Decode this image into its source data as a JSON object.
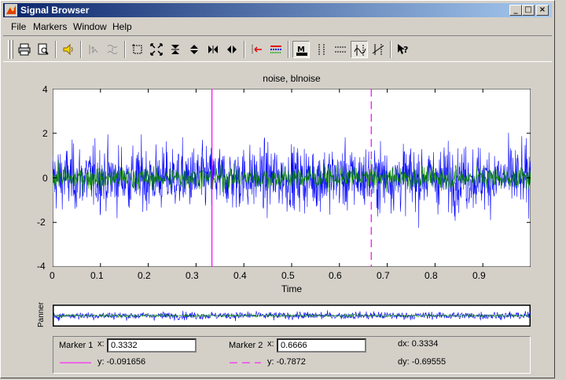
{
  "window": {
    "title": "Signal Browser",
    "controls": [
      "_",
      "□",
      "×"
    ]
  },
  "menu": [
    "File",
    "Markers",
    "Window",
    "Help"
  ],
  "toolbar": {
    "buttons": [
      "print-icon",
      "print-preview-icon",
      "play-icon",
      "select-trace-icon",
      "array-signals-icon",
      "zoom-rect-icon",
      "zoom-full-icon",
      "zoom-in-y-icon",
      "zoom-out-y-icon",
      "zoom-in-x-icon",
      "zoom-out-x-icon",
      "select-trace-arrow-icon",
      "line-props-icon",
      "markers-on-icon",
      "vertical-markers-icon",
      "horizontal-markers-icon",
      "track-markers-icon",
      "slope-markers-icon",
      "whats-this-icon"
    ],
    "pressed": [
      "markers-on-icon",
      "track-markers-icon"
    ]
  },
  "axes": {
    "title": "noise, blnoise",
    "xlabel": "Time",
    "xticks": [
      "0",
      "0.1",
      "0.2",
      "0.3",
      "0.4",
      "0.5",
      "0.6",
      "0.7",
      "0.8",
      "0.9"
    ],
    "yticks": [
      "4",
      "2",
      "0",
      "-2",
      "-4"
    ],
    "xlim": [
      0,
      1
    ],
    "ylim": [
      -4,
      4
    ]
  },
  "chart_data": {
    "type": "line",
    "title": "noise, blnoise",
    "xlabel": "Time",
    "ylabel": "",
    "xlim": [
      0,
      1
    ],
    "ylim": [
      -4,
      4
    ],
    "x_ticks": [
      0,
      0.1,
      0.2,
      0.3,
      0.4,
      0.5,
      0.6,
      0.7,
      0.8,
      0.9
    ],
    "y_ticks": [
      -4,
      -2,
      0,
      2,
      4
    ],
    "series": [
      {
        "color": "#0000ff",
        "amplitude": 1.0,
        "peak_range": [
          -3.6,
          3.6
        ]
      },
      {
        "color": "#007f00",
        "amplitude": 0.35,
        "peak_range": [
          -0.9,
          0.9
        ]
      }
    ],
    "markers": [
      {
        "x": 0.3332,
        "style": "solid",
        "color": "#ff00ff"
      },
      {
        "x": 0.6666,
        "style": "dashed",
        "color": "#ff00ff"
      }
    ]
  },
  "panner": {
    "label": "Panner"
  },
  "markers_panel": {
    "marker1_label": "Marker 1",
    "marker1_x_label": "x:",
    "marker1_x_value": "0.3332",
    "marker1_y": "y: -0.091656",
    "marker2_label": "Marker 2",
    "marker2_x_label": "x:",
    "marker2_x_value": "0.6666",
    "marker2_y": "y: -0.7872",
    "dx": "dx: 0.3334",
    "dy": "dy: -0.69555"
  },
  "colors": {
    "title_start": "#0a246a",
    "title_end": "#a6caf0",
    "marker": "#ff00ff",
    "series1": "#0000ff",
    "series2": "#007f00"
  }
}
